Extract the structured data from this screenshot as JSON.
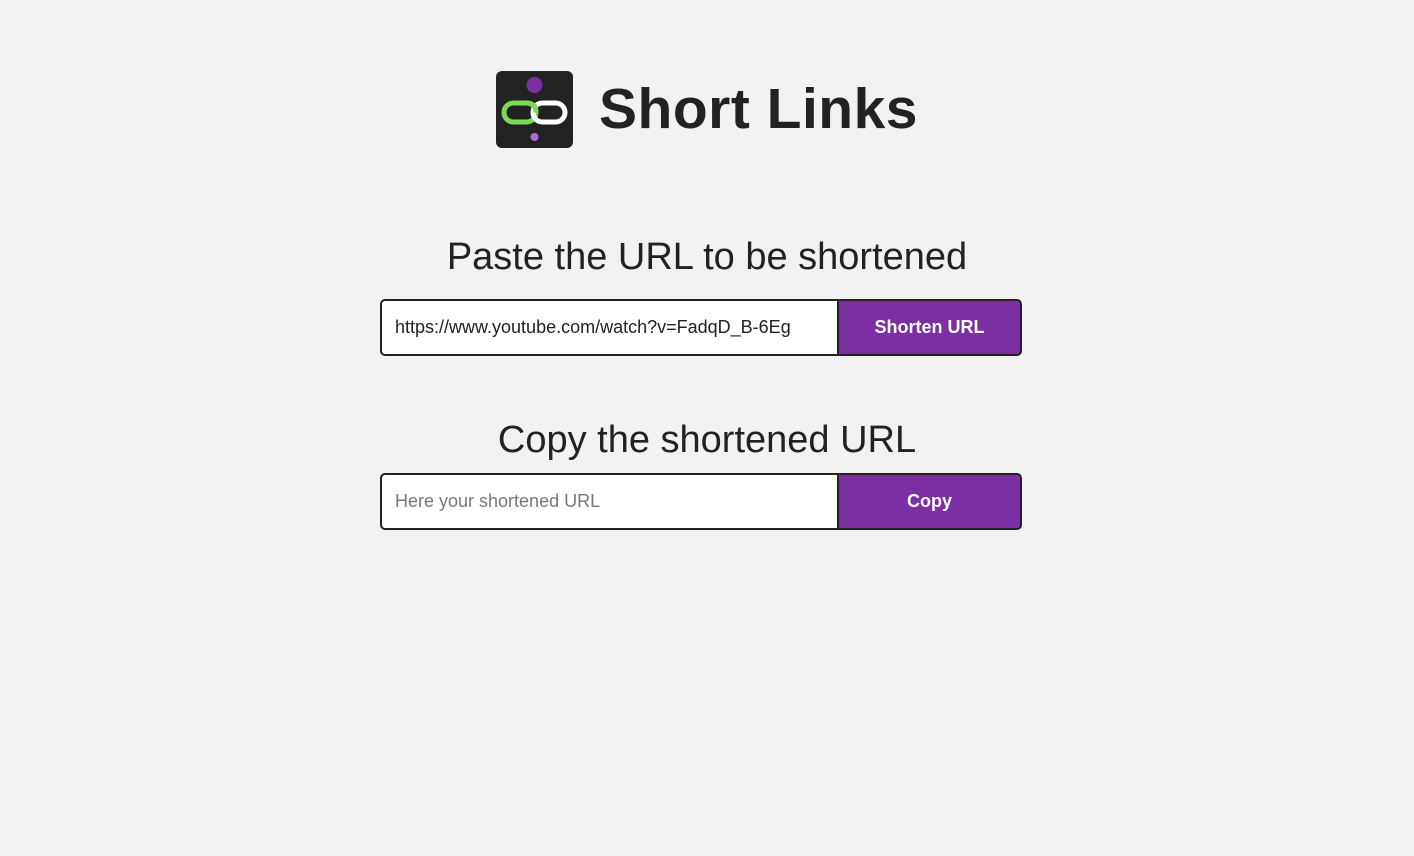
{
  "header": {
    "title": "Short Links",
    "logo_icon": "chain-link-icon",
    "logo_colors": {
      "background": "#222222",
      "link_green": "#7ed957",
      "link_white": "#ffffff",
      "dot_purple": "#7b2fa3",
      "dot_light_purple": "#b36ad9"
    }
  },
  "shorten_section": {
    "heading": "Paste the URL to be shortened",
    "input_value": "https://www.youtube.com/watch?v=FadqD_B-6Eg",
    "input_placeholder": "",
    "button_label": "Shorten URL"
  },
  "copy_section": {
    "heading": "Copy the shortened URL",
    "input_value": "",
    "input_placeholder": "Here your shortened URL",
    "button_label": "Copy"
  },
  "colors": {
    "page_background": "#f2f2f2",
    "accent": "#7b2fa3",
    "text": "#222222"
  }
}
